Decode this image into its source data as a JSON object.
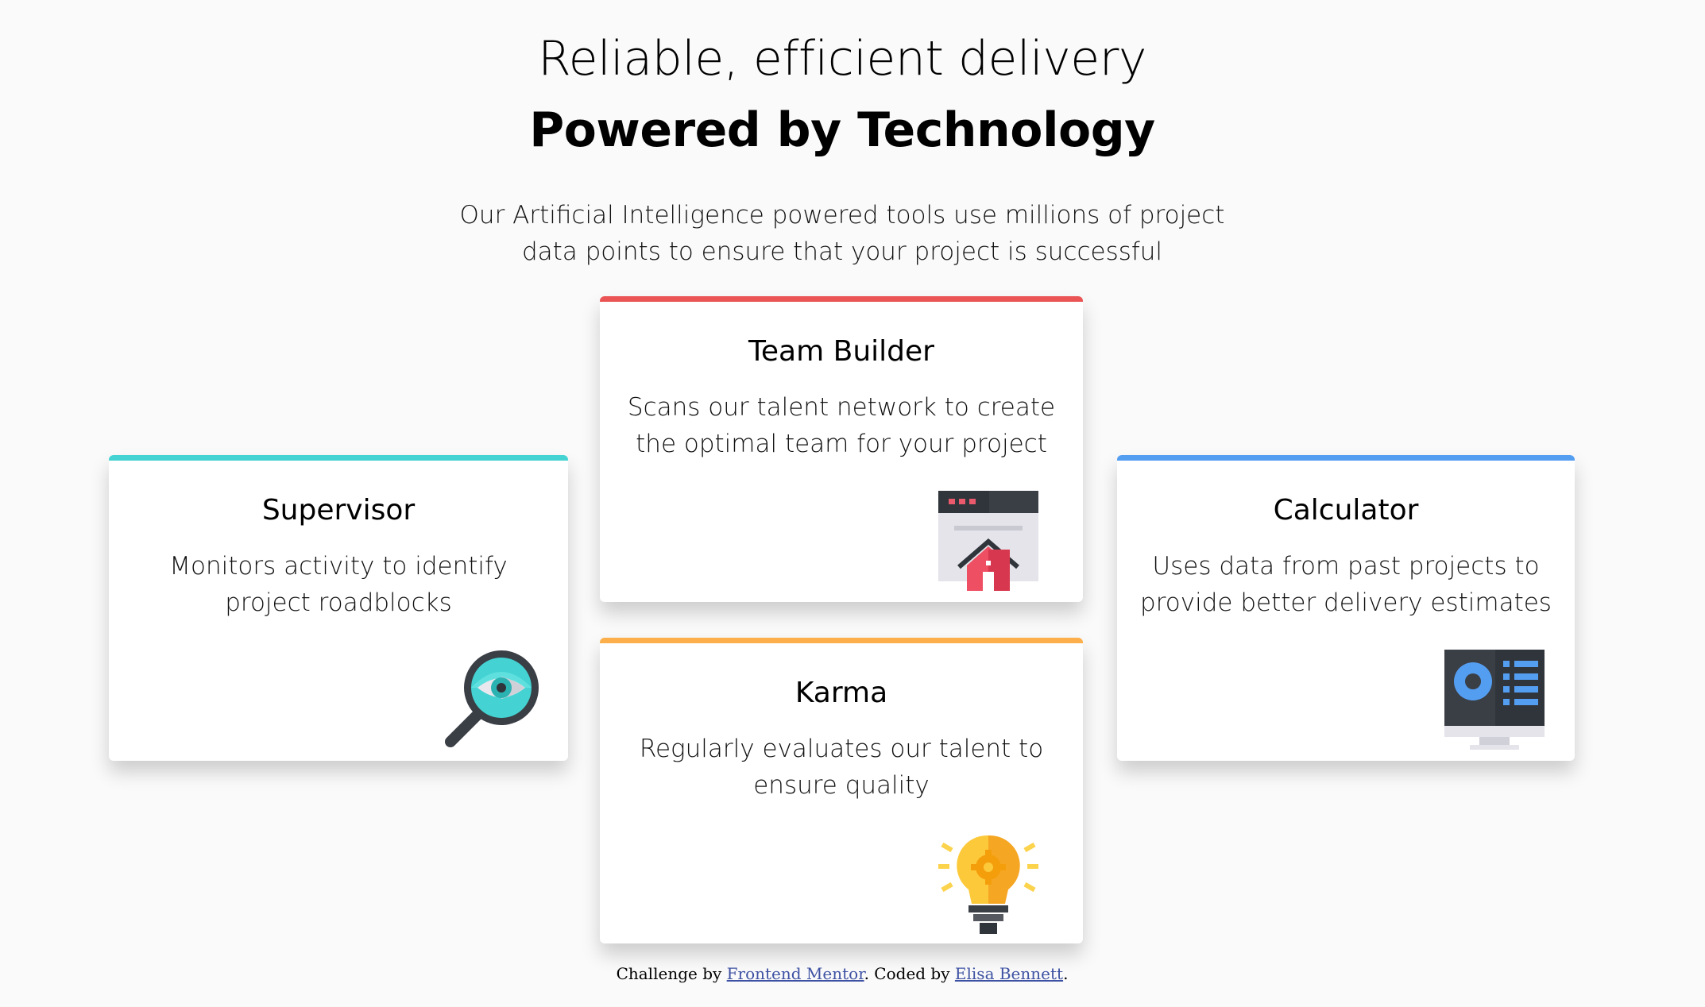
{
  "header": {
    "line1": "Reliable, efficient delivery",
    "line2": "Powered by Technology",
    "intro": "Our Artificial Intelligence powered tools use millions of project data points to ensure that your project is successful"
  },
  "cards": {
    "supervisor": {
      "title": "Supervisor",
      "text": "Monitors activity to identify project roadblocks",
      "icon": "supervisor-magnifier-icon",
      "accent": "#44d3d2"
    },
    "team_builder": {
      "title": "Team Builder",
      "text": "Scans our talent network to create the optimal team for your project",
      "icon": "team-builder-house-icon",
      "accent": "#ea5454"
    },
    "karma": {
      "title": "Karma",
      "text": "Regularly evaluates our talent to ensure quality",
      "icon": "karma-lightbulb-icon",
      "accent": "#fcaf4a"
    },
    "calculator": {
      "title": "Calculator",
      "text": "Uses data from past projects to provide better delivery estimates",
      "icon": "calculator-monitor-icon",
      "accent": "#549ef2"
    }
  },
  "footer": {
    "prefix": "Challenge by ",
    "link1": "Frontend Mentor",
    "middle": ". Coded by ",
    "link2": "Elisa Bennett",
    "suffix": "."
  }
}
